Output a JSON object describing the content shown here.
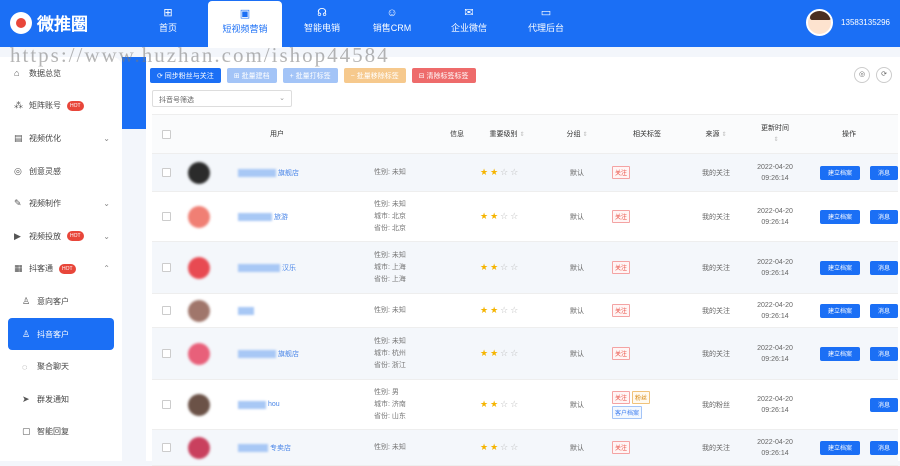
{
  "brand": {
    "name": "微推圈"
  },
  "nav": [
    {
      "icon": "grid-icon",
      "glyph": "⊞",
      "label": "首页"
    },
    {
      "icon": "video-icon",
      "glyph": "▣",
      "label": "短视频营销"
    },
    {
      "icon": "robot-icon",
      "glyph": "☊",
      "label": "智能电销"
    },
    {
      "icon": "people-icon",
      "glyph": "☺",
      "label": "销售CRM"
    },
    {
      "icon": "wechat-icon",
      "glyph": "✉",
      "label": "企业微信"
    },
    {
      "icon": "monitor-icon",
      "glyph": "▭",
      "label": "代理后台"
    }
  ],
  "user": {
    "phone": "13583135296"
  },
  "watermark": "https://www.huzhan.com/ishop44584",
  "sidebar": [
    {
      "icon": "home-icon",
      "glyph": "⌂",
      "label": "数据总览",
      "caret": "",
      "hot": ""
    },
    {
      "icon": "matrix-icon",
      "glyph": "⁂",
      "label": "矩阵账号",
      "caret": "",
      "hot": "HOT"
    },
    {
      "icon": "chart-icon",
      "glyph": "▤",
      "label": "视频优化",
      "caret": "⌄",
      "hot": ""
    },
    {
      "icon": "bulb-icon",
      "glyph": "◎",
      "label": "创意灵感",
      "caret": "",
      "hot": ""
    },
    {
      "icon": "pen-icon",
      "glyph": "✎",
      "label": "视频制作",
      "caret": "⌄",
      "hot": ""
    },
    {
      "icon": "play-icon",
      "glyph": "▶",
      "label": "视频投放",
      "caret": "⌄",
      "hot": "HOT"
    },
    {
      "icon": "customer-icon",
      "glyph": "▦",
      "label": "抖客通",
      "caret": "⌃",
      "hot": "HOT"
    },
    {
      "icon": "person-icon",
      "glyph": "♙",
      "label": "意向客户",
      "caret": "",
      "hot": ""
    },
    {
      "icon": "douyin-user-icon",
      "glyph": "♙",
      "label": "抖音客户",
      "caret": "",
      "hot": ""
    },
    {
      "icon": "chat-icon",
      "glyph": "◌",
      "label": "聚合聊天",
      "caret": "",
      "hot": ""
    },
    {
      "icon": "send-icon",
      "glyph": "➤",
      "label": "群发通知",
      "caret": "",
      "hot": ""
    },
    {
      "icon": "reply-icon",
      "glyph": "▢",
      "label": "智能回复",
      "caret": "",
      "hot": ""
    }
  ],
  "toolbar": [
    {
      "label": "⟳ 同步粉丝与关注",
      "cls": "b1"
    },
    {
      "label": "⊞ 批量建档",
      "cls": "b2"
    },
    {
      "label": "+ 批量打标签",
      "cls": "b3"
    },
    {
      "label": "− 批量移除标签",
      "cls": "b4"
    },
    {
      "label": "⊟ 清除标签标签",
      "cls": "b5"
    }
  ],
  "filter": {
    "placeholder": "抖音号筛选"
  },
  "table": {
    "headers": {
      "user": "用户",
      "info": "信息",
      "level": "重要级别",
      "group": "分组",
      "tags": "相关标签",
      "source": "来源",
      "time": "更新时间",
      "ops": "操作"
    },
    "rows": [
      {
        "name": "旗舰店",
        "avatar": "#2b2b2b",
        "info": [
          "性别: 未知"
        ],
        "stars": 2,
        "group": "默认",
        "tags": [
          {
            "t": "关注",
            "c": ""
          }
        ],
        "source": "我的关注",
        "date": "2022-04-20",
        "clock": "09:26:14",
        "ops": [
          "建立档案",
          "消息"
        ],
        "alt": true,
        "h": 38
      },
      {
        "name": "旅游",
        "avatar": "#f07f74",
        "info": [
          "性别: 未知",
          "城市: 北京",
          "省份: 北京"
        ],
        "stars": 2,
        "group": "默认",
        "tags": [
          {
            "t": "关注",
            "c": ""
          }
        ],
        "source": "我的关注",
        "date": "2022-04-20",
        "clock": "09:26:14",
        "ops": [
          "建立档案",
          "消息"
        ],
        "alt": false,
        "h": 50
      },
      {
        "name": "汉乐",
        "avatar": "#e84a52",
        "info": [
          "性别: 未知",
          "城市: 上海",
          "省份: 上海"
        ],
        "stars": 2,
        "group": "默认",
        "tags": [
          {
            "t": "关注",
            "c": ""
          }
        ],
        "source": "我的关注",
        "date": "2022-04-20",
        "clock": "09:26:14",
        "ops": [
          "建立档案",
          "消息"
        ],
        "alt": true,
        "h": 52
      },
      {
        "name": "",
        "avatar": "#a0766b",
        "info": [
          "性别: 未知"
        ],
        "stars": 2,
        "group": "默认",
        "tags": [
          {
            "t": "关注",
            "c": ""
          }
        ],
        "source": "我的关注",
        "date": "2022-04-20",
        "clock": "09:26:14",
        "ops": [
          "建立档案",
          "消息"
        ],
        "alt": false,
        "h": 34
      },
      {
        "name": "旗舰店",
        "avatar": "#e8607a",
        "info": [
          "性别: 未知",
          "城市: 杭州",
          "省份: 浙江"
        ],
        "stars": 2,
        "group": "默认",
        "tags": [
          {
            "t": "关注",
            "c": ""
          }
        ],
        "source": "我的关注",
        "date": "2022-04-20",
        "clock": "09:26:14",
        "ops": [
          "建立档案",
          "消息"
        ],
        "alt": true,
        "h": 52
      },
      {
        "name": "hou",
        "avatar": "#6b5247",
        "info": [
          "性别: 男",
          "城市: 济南",
          "省份: 山东"
        ],
        "stars": 2,
        "group": "默认",
        "tags": [
          {
            "t": "关注",
            "c": ""
          },
          {
            "t": "粉丝",
            "c": "g"
          },
          {
            "t": "客户档案",
            "c": "b"
          }
        ],
        "source": "我的粉丝",
        "date": "2022-04-20",
        "clock": "09:26:14",
        "ops": [
          "消息"
        ],
        "alt": false,
        "h": 50
      },
      {
        "name": "专卖店",
        "avatar": "#c9405e",
        "info": [
          "性别: 未知"
        ],
        "stars": 2,
        "group": "默认",
        "tags": [
          {
            "t": "关注",
            "c": ""
          }
        ],
        "source": "我的关注",
        "date": "2022-04-20",
        "clock": "09:26:14",
        "ops": [
          "建立档案",
          "消息"
        ],
        "alt": true,
        "h": 36
      }
    ]
  }
}
